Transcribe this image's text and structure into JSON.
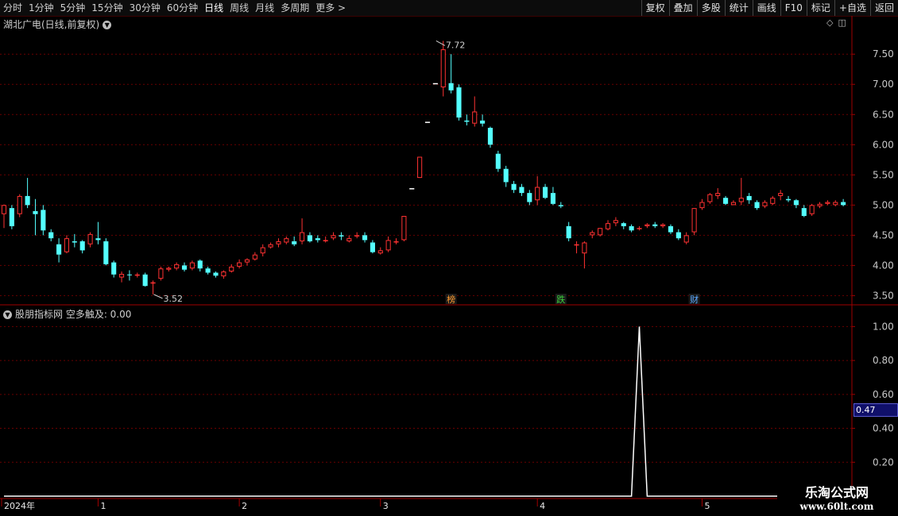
{
  "toolbar": {
    "periods": [
      "分时",
      "1分钟",
      "5分钟",
      "15分钟",
      "30分钟",
      "60分钟",
      "日线",
      "周线",
      "月线",
      "多周期",
      "更多 >"
    ],
    "active_period": "日线",
    "right_buttons": [
      "复权",
      "叠加",
      "多股",
      "统计",
      "画线",
      "F10",
      "标记",
      "+自选",
      "返回"
    ]
  },
  "main_panel": {
    "title": "湖北广电(日线,前复权)"
  },
  "indicator_panel": {
    "title": "股朋指标网 空多触及: 0.00",
    "current_value": "0.47"
  },
  "watermark": {
    "line1": "乐淘公式网",
    "line2": "www.60lt.com"
  },
  "colors": {
    "up": "#ff3232",
    "down": "#54ffff",
    "grid": "#6a0000",
    "border": "#a00000",
    "axis_text": "#c8c8c8"
  },
  "chart_data": [
    {
      "type": "candlestick",
      "title": "湖北广电(日线,前复权)",
      "ylim": [
        3.4,
        7.95
      ],
      "yticks": [
        3.5,
        4.0,
        4.5,
        5.0,
        5.5,
        6.0,
        6.5,
        7.0,
        7.5
      ],
      "ytick_labels": [
        "3.50",
        "4.00",
        "4.50",
        "5.00",
        "5.50",
        "6.00",
        "6.50",
        "7.00",
        "7.50"
      ],
      "x_month_labels": [
        {
          "index": 0,
          "label": "2024年"
        },
        {
          "index": 12,
          "label": "1"
        },
        {
          "index": 30,
          "label": "2"
        },
        {
          "index": 48,
          "label": "3"
        },
        {
          "index": 68,
          "label": "4"
        },
        {
          "index": 89,
          "label": "5"
        }
      ],
      "annotations": [
        {
          "index": 55,
          "price": 7.72,
          "label": "7.72"
        },
        {
          "index": 19,
          "price": 3.52,
          "label": "3.52"
        }
      ],
      "event_markers": [
        {
          "index": 57,
          "label": "榜"
        },
        {
          "index": 71,
          "label": "跌"
        },
        {
          "index": 88,
          "label": "财"
        }
      ],
      "candles": [
        [
          4.85,
          5.0,
          4.62,
          5.01
        ],
        [
          4.95,
          4.65,
          4.6,
          5.0
        ],
        [
          4.85,
          5.15,
          4.8,
          5.18
        ],
        [
          5.15,
          5.0,
          4.95,
          5.45
        ],
        [
          4.9,
          4.85,
          4.5,
          5.1
        ],
        [
          4.92,
          4.58,
          4.5,
          5.0
        ],
        [
          4.55,
          4.45,
          4.4,
          4.6
        ],
        [
          4.35,
          4.18,
          4.05,
          4.45
        ],
        [
          4.22,
          4.45,
          4.2,
          4.5
        ],
        [
          4.4,
          4.38,
          4.3,
          4.52
        ],
        [
          4.4,
          4.25,
          4.2,
          4.42
        ],
        [
          4.35,
          4.52,
          4.3,
          4.55
        ],
        [
          4.45,
          4.42,
          4.35,
          4.72
        ],
        [
          4.4,
          4.02,
          4.0,
          4.45
        ],
        [
          4.05,
          3.85,
          3.8,
          4.08
        ],
        [
          3.8,
          3.86,
          3.72,
          3.9
        ],
        [
          3.85,
          3.84,
          3.75,
          3.92
        ],
        [
          3.85,
          3.85,
          3.8,
          3.88
        ],
        [
          3.85,
          3.66,
          3.65,
          3.88
        ],
        [
          3.7,
          3.72,
          3.52,
          3.75
        ],
        [
          3.78,
          3.95,
          3.75,
          3.98
        ],
        [
          3.93,
          3.96,
          3.9,
          3.98
        ],
        [
          3.95,
          4.02,
          3.92,
          4.05
        ],
        [
          4.0,
          3.93,
          3.9,
          4.05
        ],
        [
          3.95,
          4.05,
          3.92,
          4.08
        ],
        [
          4.08,
          3.95,
          3.9,
          4.1
        ],
        [
          3.95,
          3.88,
          3.85,
          3.98
        ],
        [
          3.88,
          3.83,
          3.8,
          3.9
        ],
        [
          3.82,
          3.9,
          3.78,
          3.92
        ],
        [
          3.9,
          3.98,
          3.88,
          4.02
        ],
        [
          3.98,
          4.05,
          3.95,
          4.1
        ],
        [
          4.05,
          4.1,
          4.0,
          4.12
        ],
        [
          4.1,
          4.18,
          4.08,
          4.22
        ],
        [
          4.2,
          4.3,
          4.15,
          4.35
        ],
        [
          4.3,
          4.35,
          4.28,
          4.38
        ],
        [
          4.35,
          4.4,
          4.3,
          4.45
        ],
        [
          4.38,
          4.45,
          4.35,
          4.48
        ],
        [
          4.4,
          4.35,
          4.32,
          4.48
        ],
        [
          4.4,
          4.55,
          4.35,
          4.78
        ],
        [
          4.5,
          4.4,
          4.38,
          4.55
        ],
        [
          4.45,
          4.42,
          4.38,
          4.5
        ],
        [
          4.4,
          4.42,
          4.38,
          4.48
        ],
        [
          4.45,
          4.5,
          4.42,
          4.55
        ],
        [
          4.5,
          4.48,
          4.42,
          4.55
        ],
        [
          4.4,
          4.45,
          4.38,
          4.5
        ],
        [
          4.48,
          4.5,
          4.45,
          4.55
        ],
        [
          4.5,
          4.42,
          4.38,
          4.55
        ],
        [
          4.38,
          4.22,
          4.2,
          4.42
        ],
        [
          4.2,
          4.25,
          4.18,
          4.3
        ],
        [
          4.25,
          4.42,
          4.22,
          4.48
        ],
        [
          4.38,
          4.4,
          4.35,
          4.45
        ],
        [
          4.42,
          4.82,
          4.4,
          4.82
        ],
        [
          5.28,
          5.28,
          5.28,
          5.28
        ],
        [
          5.45,
          5.8,
          5.45,
          5.8
        ],
        [
          6.38,
          6.38,
          6.38,
          6.38
        ],
        [
          7.02,
          7.02,
          7.02,
          7.02
        ],
        [
          6.95,
          7.58,
          6.8,
          7.72
        ],
        [
          7.02,
          6.9,
          6.85,
          7.5
        ],
        [
          6.95,
          6.45,
          6.4,
          7.0
        ],
        [
          6.4,
          6.38,
          6.32,
          6.5
        ],
        [
          6.35,
          6.55,
          6.3,
          6.8
        ],
        [
          6.4,
          6.35,
          6.3,
          6.5
        ],
        [
          6.28,
          6.0,
          5.95,
          6.3
        ],
        [
          5.85,
          5.6,
          5.55,
          5.9
        ],
        [
          5.6,
          5.38,
          5.3,
          5.65
        ],
        [
          5.35,
          5.25,
          5.2,
          5.4
        ],
        [
          5.3,
          5.2,
          5.15,
          5.35
        ],
        [
          5.2,
          5.05,
          5.0,
          5.25
        ],
        [
          5.08,
          5.3,
          5.0,
          5.48
        ],
        [
          5.3,
          5.12,
          5.1,
          5.35
        ],
        [
          5.2,
          5.02,
          5.0,
          5.3
        ],
        [
          5.0,
          4.98,
          4.95,
          5.05
        ],
        [
          4.65,
          4.45,
          4.4,
          4.72
        ],
        [
          4.35,
          4.35,
          4.2,
          4.4
        ],
        [
          4.2,
          4.38,
          3.95,
          4.4
        ],
        [
          4.5,
          4.55,
          4.45,
          4.58
        ],
        [
          4.5,
          4.62,
          4.48,
          4.62
        ],
        [
          4.6,
          4.7,
          4.58,
          4.75
        ],
        [
          4.7,
          4.75,
          4.65,
          4.8
        ],
        [
          4.7,
          4.65,
          4.6,
          4.72
        ],
        [
          4.65,
          4.58,
          4.55,
          4.68
        ],
        [
          4.62,
          4.62,
          4.58,
          4.65
        ],
        [
          4.65,
          4.68,
          4.62,
          4.7
        ],
        [
          4.68,
          4.65,
          4.62,
          4.72
        ],
        [
          4.65,
          4.68,
          4.62,
          4.7
        ],
        [
          4.65,
          4.55,
          4.52,
          4.68
        ],
        [
          4.55,
          4.45,
          4.42,
          4.6
        ],
        [
          4.38,
          4.5,
          4.35,
          4.55
        ],
        [
          4.55,
          4.95,
          4.5,
          4.95
        ],
        [
          4.95,
          5.05,
          4.92,
          5.1
        ],
        [
          5.05,
          5.18,
          5.02,
          5.2
        ],
        [
          5.15,
          5.2,
          5.1,
          5.28
        ],
        [
          5.12,
          5.02,
          5.0,
          5.15
        ],
        [
          5.0,
          5.05,
          5.0,
          5.08
        ],
        [
          5.05,
          5.12,
          5.0,
          5.45
        ],
        [
          5.15,
          5.08,
          5.02,
          5.2
        ],
        [
          5.05,
          4.95,
          4.92,
          5.08
        ],
        [
          4.98,
          5.05,
          4.95,
          5.08
        ],
        [
          5.02,
          5.12,
          5.0,
          5.15
        ],
        [
          5.15,
          5.2,
          5.08,
          5.25
        ],
        [
          5.1,
          5.08,
          5.05,
          5.15
        ],
        [
          5.08,
          5.0,
          4.95,
          5.1
        ],
        [
          4.95,
          4.82,
          4.8,
          5.0
        ],
        [
          4.85,
          5.0,
          4.82,
          5.02
        ],
        [
          4.98,
          5.02,
          4.95,
          5.05
        ],
        [
          5.02,
          5.05,
          5.0,
          5.08
        ],
        [
          5.0,
          5.05,
          4.98,
          5.08
        ],
        [
          5.05,
          5.0,
          4.98,
          5.1
        ]
      ]
    },
    {
      "type": "line",
      "title": "股朋指标网 空多触及: 0.00",
      "ylim": [
        0,
        1.1
      ],
      "yticks": [
        0.2,
        0.4,
        0.6,
        0.8,
        1.0
      ],
      "ytick_labels": [
        "0.20",
        "0.40",
        "0.60",
        "0.80",
        "1.00"
      ],
      "spike": {
        "start_index": 80,
        "peak_index": 81,
        "end_index": 82,
        "peak_value": 1.0
      },
      "baseline_value": 0.0
    }
  ]
}
